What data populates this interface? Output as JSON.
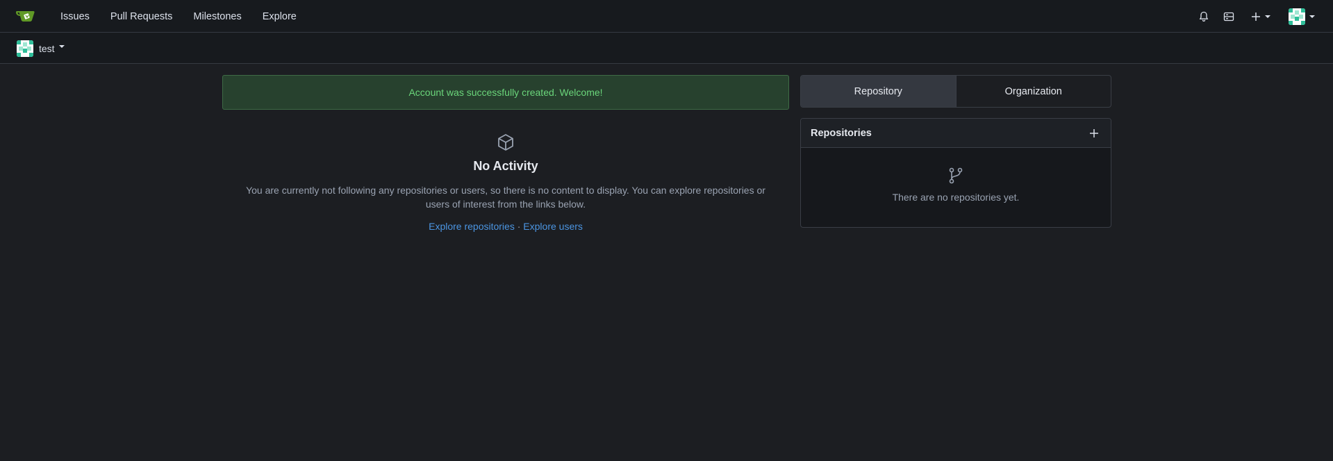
{
  "nav": {
    "links": [
      "Issues",
      "Pull Requests",
      "Milestones",
      "Explore"
    ]
  },
  "context": {
    "name": "test"
  },
  "flash": {
    "message": "Account was successfully created. Welcome!"
  },
  "activity": {
    "title": "No Activity",
    "description": "You are currently not following any repositories or users, so there is no content to display. You can explore repositories or users of interest from the links below.",
    "explore_repos": "Explore repositories",
    "separator": "·",
    "explore_users": "Explore users"
  },
  "tabs": [
    "Repository",
    "Organization"
  ],
  "repos": {
    "title": "Repositories",
    "empty": "There are no repositories yet."
  },
  "colors": {
    "background": "#1c1e22",
    "accent": "#4b95e2",
    "success": "#6bd67b",
    "brand": "#609926"
  }
}
